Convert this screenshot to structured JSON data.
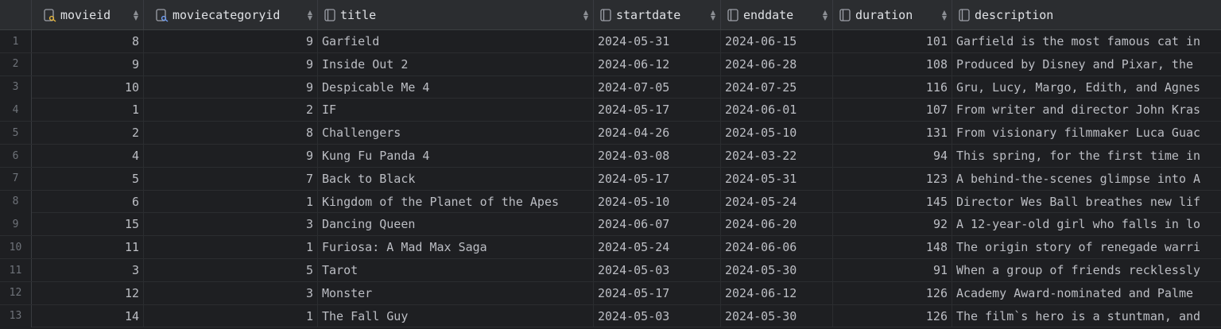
{
  "columns": [
    {
      "label": "movieid",
      "icon": "primary-key-column-icon"
    },
    {
      "label": "moviecategoryid",
      "icon": "foreign-key-column-icon"
    },
    {
      "label": "title",
      "icon": "column-icon"
    },
    {
      "label": "startdate",
      "icon": "column-icon"
    },
    {
      "label": "enddate",
      "icon": "column-icon"
    },
    {
      "label": "duration",
      "icon": "column-icon"
    },
    {
      "label": "description",
      "icon": "column-icon"
    }
  ],
  "rows": [
    {
      "n": "1",
      "movieid": "8",
      "moviecategoryid": "9",
      "title": "Garfield",
      "startdate": "2024-05-31",
      "enddate": "2024-06-15",
      "duration": "101",
      "description": "Garfield is the most famous cat in"
    },
    {
      "n": "2",
      "movieid": "9",
      "moviecategoryid": "9",
      "title": "Inside Out 2",
      "startdate": "2024-06-12",
      "enddate": "2024-06-28",
      "duration": "108",
      "description": "Produced by Disney and Pixar, the"
    },
    {
      "n": "3",
      "movieid": "10",
      "moviecategoryid": "9",
      "title": "Despicable Me 4",
      "startdate": "2024-07-05",
      "enddate": "2024-07-25",
      "duration": "116",
      "description": "Gru, Lucy, Margo, Edith, and Agnes"
    },
    {
      "n": "4",
      "movieid": "1",
      "moviecategoryid": "2",
      "title": "IF",
      "startdate": "2024-05-17",
      "enddate": "2024-06-01",
      "duration": "107",
      "description": "From writer and director John Kras"
    },
    {
      "n": "5",
      "movieid": "2",
      "moviecategoryid": "8",
      "title": "Challengers",
      "startdate": "2024-04-26",
      "enddate": "2024-05-10",
      "duration": "131",
      "description": "From visionary filmmaker Luca Guac"
    },
    {
      "n": "6",
      "movieid": "4",
      "moviecategoryid": "9",
      "title": "Kung Fu Panda 4",
      "startdate": "2024-03-08",
      "enddate": "2024-03-22",
      "duration": "94",
      "description": "This spring, for the first time in"
    },
    {
      "n": "7",
      "movieid": "5",
      "moviecategoryid": "7",
      "title": "Back to Black",
      "startdate": "2024-05-17",
      "enddate": "2024-05-31",
      "duration": "123",
      "description": "A behind-the-scenes glimpse into A"
    },
    {
      "n": "8",
      "movieid": "6",
      "moviecategoryid": "1",
      "title": "Kingdom of the Planet of the Apes",
      "startdate": "2024-05-10",
      "enddate": "2024-05-24",
      "duration": "145",
      "description": "Director Wes Ball breathes new lif"
    },
    {
      "n": "9",
      "movieid": "15",
      "moviecategoryid": "3",
      "title": "Dancing Queen",
      "startdate": "2024-06-07",
      "enddate": "2024-06-20",
      "duration": "92",
      "description": "A 12-year-old girl who falls in lo"
    },
    {
      "n": "10",
      "movieid": "11",
      "moviecategoryid": "1",
      "title": "Furiosa: A Mad Max Saga",
      "startdate": "2024-05-24",
      "enddate": "2024-06-06",
      "duration": "148",
      "description": "The origin story of renegade warri"
    },
    {
      "n": "11",
      "movieid": "3",
      "moviecategoryid": "5",
      "title": "Tarot",
      "startdate": "2024-05-03",
      "enddate": "2024-05-30",
      "duration": "91",
      "description": "When a group of friends recklessly"
    },
    {
      "n": "12",
      "movieid": "12",
      "moviecategoryid": "3",
      "title": "Monster",
      "startdate": "2024-05-17",
      "enddate": "2024-06-12",
      "duration": "126",
      "description": "Academy Award-nominated and Palme"
    },
    {
      "n": "13",
      "movieid": "14",
      "moviecategoryid": "1",
      "title": "The Fall Guy",
      "startdate": "2024-05-03",
      "enddate": "2024-05-30",
      "duration": "126",
      "description": "The film`s hero is a stuntman, and"
    }
  ]
}
